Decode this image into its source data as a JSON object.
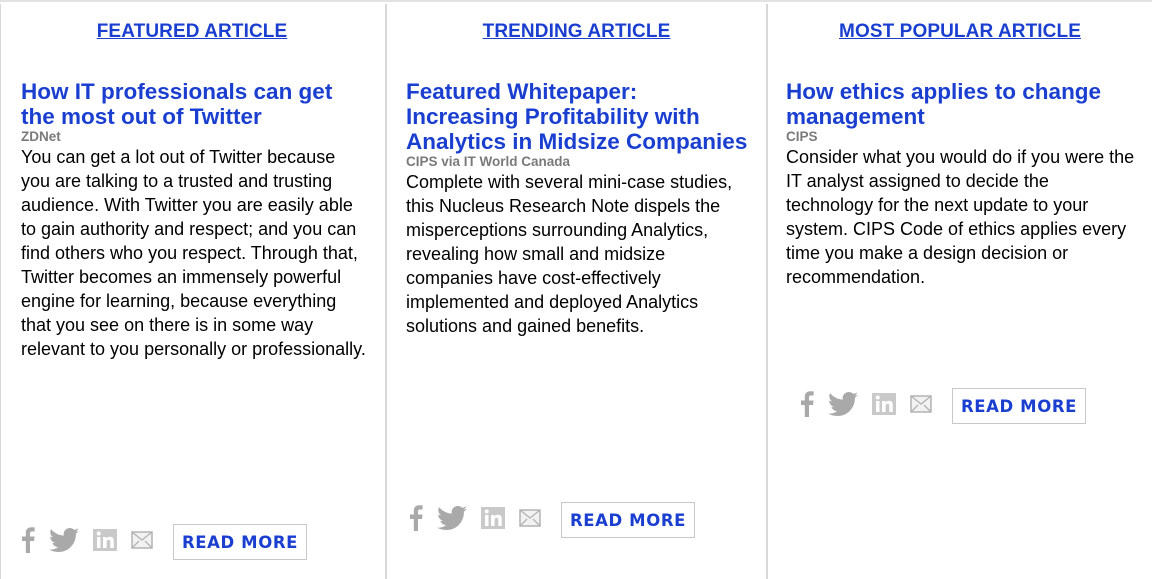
{
  "columns": [
    {
      "heading": "FEATURED ARTICLE",
      "title": "How IT professionals can get the most out of Twitter",
      "source": "ZDNet",
      "body": "You can get a lot out of Twitter because you are talking to a trusted and trusting audience. With Twitter you are easily able to gain authority and respect; and you can find others who you respect. Through that, Twitter becomes an immensely powerful engine for learning, because everything that you see on there is in some way relevant to you personally or professionally.",
      "read_more": "READ MORE"
    },
    {
      "heading": "TRENDING ARTICLE",
      "title": "Featured Whitepaper: Increasing Profitability with Analytics in Midsize Companies",
      "source": "CIPS via IT World Canada",
      "body": "Complete with several mini-case studies, this Nucleus Research Note dispels the misperceptions surrounding Analytics, revealing how small and midsize companies have cost-effectively implemented and deployed Analytics solutions and gained benefits.",
      "read_more": "READ MORE"
    },
    {
      "heading": "MOST POPULAR ARTICLE",
      "title": "How ethics applies to change management",
      "source": "CIPS",
      "body": "Consider what you would do if you were the IT analyst assigned to decide the technology for the next update to your system. CIPS Code of ethics applies every time you make a design decision or recommendation.",
      "read_more": "READ MORE"
    }
  ],
  "icons": [
    "facebook-icon",
    "twitter-icon",
    "linkedin-icon",
    "email-icon"
  ],
  "colors": {
    "link": "#1a3fd0",
    "source": "#7a7a7a",
    "icon": "#a9a9a9",
    "divider": "#d8d8d8"
  }
}
